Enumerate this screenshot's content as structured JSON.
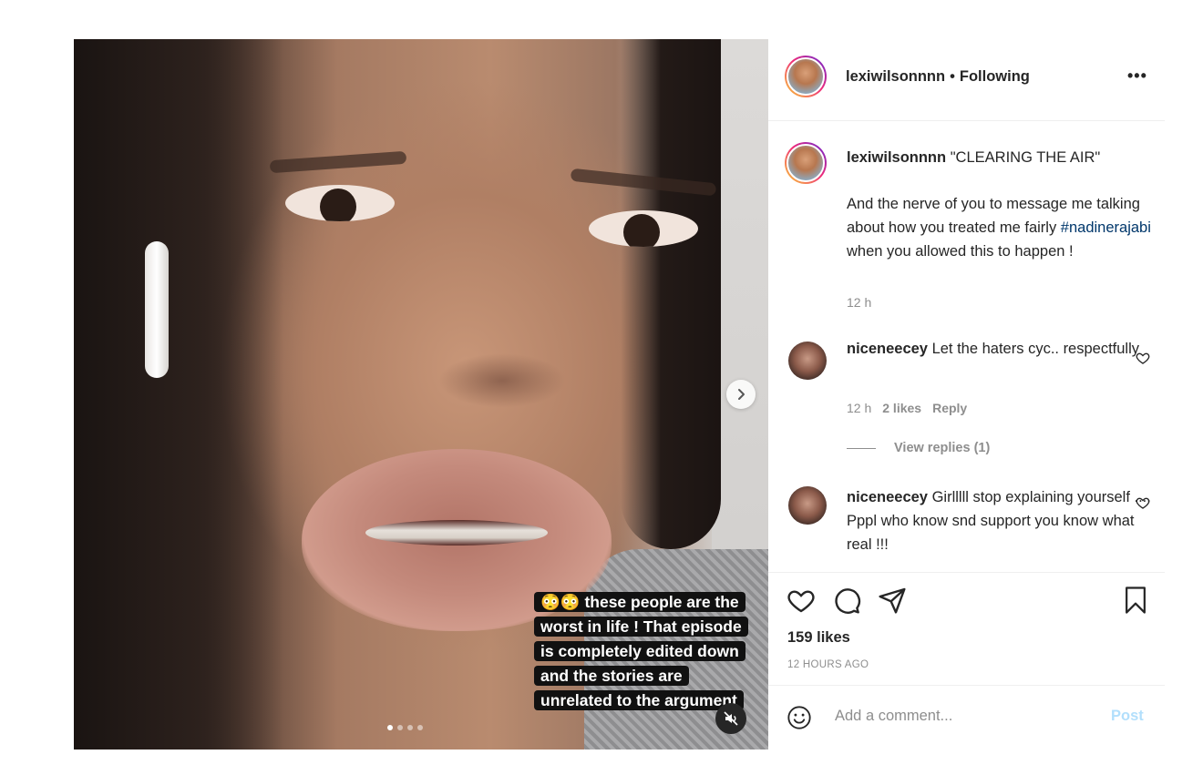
{
  "header": {
    "username": "lexiwilsonnnn",
    "separator": "•",
    "follow_status": "Following",
    "more_label": "•••"
  },
  "media": {
    "caption": "😳😳 these people are the worst in life ! That episode is completely edited down and the stories are unrelated to the argument",
    "carousel_total": 4,
    "carousel_active": 1
  },
  "post": {
    "username": "lexiwilsonnnn",
    "title": "\"CLEARING THE AIR\"",
    "body_before": "And the nerve of you to message me talking about how you treated me fairly ",
    "hashtag": "#nadinerajabi",
    "body_after": " when you allowed this to happen !",
    "time": "12 h"
  },
  "comments": [
    {
      "username": "niceneecey",
      "text": "Let the haters cyc.. respectfully",
      "time": "12 h",
      "likes": "2 likes",
      "reply_label": "Reply",
      "view_replies": "View replies (1)"
    },
    {
      "username": "niceneecey",
      "text": "Girlllll stop explaining yourself .... Pppl who know snd support you know what real !!!"
    }
  ],
  "actions": {
    "likes": "159 likes",
    "time_ago": "12 HOURS AGO",
    "add_comment_placeholder": "Add a comment...",
    "post_label": "Post"
  },
  "colors": {
    "text": "#262626",
    "muted": "#8e8e8e",
    "hashtag": "#00376b",
    "post_disabled": "#b2dffc"
  }
}
